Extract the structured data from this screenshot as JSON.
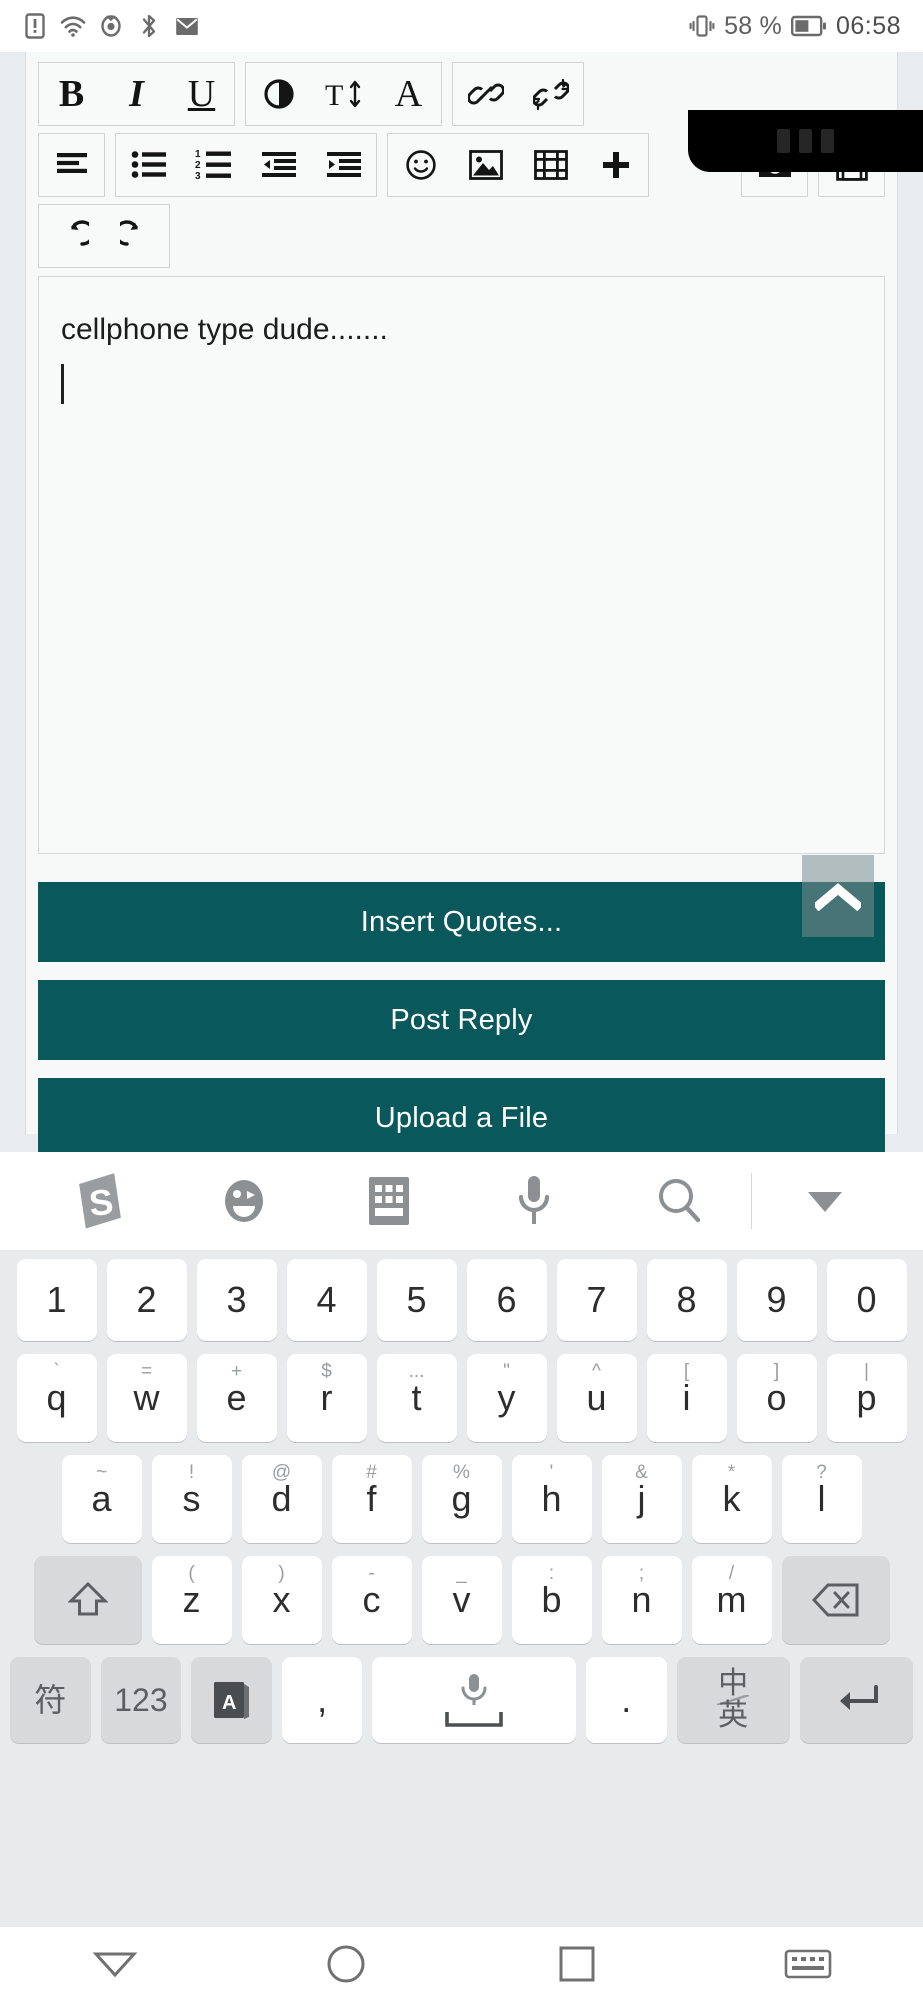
{
  "status_bar": {
    "left_icons": [
      "sim-alert-icon",
      "wifi-icon",
      "eye-comfort-icon",
      "bluetooth-icon",
      "mail-icon"
    ],
    "right_icons": [
      "vibrate-icon",
      "battery-icon"
    ],
    "battery_percent": "58 %",
    "clock": "06:58"
  },
  "editor": {
    "toolbar_row1": [
      {
        "name": "bold-icon",
        "label": "B"
      },
      {
        "name": "italic-icon",
        "label": "I"
      },
      {
        "name": "underline-icon",
        "label": "U"
      },
      {
        "name": "text-contrast-icon",
        "label": "O"
      },
      {
        "name": "font-size-icon",
        "label": "T"
      },
      {
        "name": "text-color-icon",
        "label": "A"
      },
      {
        "name": "insert-link-icon",
        "label": ""
      },
      {
        "name": "unlink-icon",
        "label": ""
      }
    ],
    "toolbar_row2": [
      {
        "name": "align-left-icon",
        "label": ""
      },
      {
        "name": "bulleted-list-icon",
        "label": ""
      },
      {
        "name": "numbered-list-icon",
        "label": ""
      },
      {
        "name": "outdent-icon",
        "label": ""
      },
      {
        "name": "indent-icon",
        "label": ""
      },
      {
        "name": "emoji-icon",
        "label": ""
      },
      {
        "name": "insert-image-icon",
        "label": ""
      },
      {
        "name": "insert-video-icon",
        "label": ""
      },
      {
        "name": "more-plus-icon",
        "label": ""
      },
      {
        "name": "camera-icon",
        "label": ""
      },
      {
        "name": "save-draft-icon",
        "label": ""
      }
    ],
    "toolbar_row3": [
      {
        "name": "undo-icon",
        "label": ""
      },
      {
        "name": "redo-icon",
        "label": ""
      }
    ],
    "compose_text": "cellphone type dude.......",
    "compose_placeholder": ""
  },
  "actions": {
    "accent_color": "#09585c",
    "buttons": [
      {
        "name": "insert-quotes-button",
        "label": "Insert Quotes..."
      },
      {
        "name": "post-reply-button",
        "label": "Post Reply"
      },
      {
        "name": "upload-file-button",
        "label": "Upload a File"
      }
    ],
    "scroll_top_icon": "chevron-up-icon"
  },
  "keyboard": {
    "toolbar": [
      "sogou-logo-icon",
      "emoji-face-icon",
      "keyboard-layout-icon",
      "microphone-icon",
      "search-icon",
      "collapse-keyboard-icon"
    ],
    "row1": [
      {
        "main": "1",
        "sub": ""
      },
      {
        "main": "2",
        "sub": ""
      },
      {
        "main": "3",
        "sub": ""
      },
      {
        "main": "4",
        "sub": ""
      },
      {
        "main": "5",
        "sub": ""
      },
      {
        "main": "6",
        "sub": ""
      },
      {
        "main": "7",
        "sub": ""
      },
      {
        "main": "8",
        "sub": ""
      },
      {
        "main": "9",
        "sub": ""
      },
      {
        "main": "0",
        "sub": ""
      }
    ],
    "row2": [
      {
        "main": "q",
        "sub": "`"
      },
      {
        "main": "w",
        "sub": "="
      },
      {
        "main": "e",
        "sub": "+"
      },
      {
        "main": "r",
        "sub": "$"
      },
      {
        "main": "t",
        "sub": "..."
      },
      {
        "main": "y",
        "sub": "\""
      },
      {
        "main": "u",
        "sub": "^"
      },
      {
        "main": "i",
        "sub": "["
      },
      {
        "main": "o",
        "sub": "]"
      },
      {
        "main": "p",
        "sub": "|"
      }
    ],
    "row3": [
      {
        "main": "a",
        "sub": "~"
      },
      {
        "main": "s",
        "sub": "!"
      },
      {
        "main": "d",
        "sub": "@"
      },
      {
        "main": "f",
        "sub": "#"
      },
      {
        "main": "g",
        "sub": "%"
      },
      {
        "main": "h",
        "sub": "'"
      },
      {
        "main": "j",
        "sub": "&"
      },
      {
        "main": "k",
        "sub": "*"
      },
      {
        "main": "l",
        "sub": "?"
      }
    ],
    "row4": [
      {
        "main": "z",
        "sub": "("
      },
      {
        "main": "x",
        "sub": ")"
      },
      {
        "main": "c",
        "sub": "-"
      },
      {
        "main": "v",
        "sub": "_"
      },
      {
        "main": "b",
        "sub": ":"
      },
      {
        "main": "n",
        "sub": ";"
      },
      {
        "main": "m",
        "sub": "/"
      }
    ],
    "shift_key": "shift-icon",
    "backspace_key": "backspace-icon",
    "row5": {
      "symbol": "符",
      "numbers": "123",
      "abc": "A",
      "comma": ",",
      "space_icon": "microphone-space-icon",
      "period": ".",
      "lang_top": "中",
      "lang_bottom": "英",
      "enter_icon": "enter-icon"
    }
  },
  "navbar": [
    "back-icon",
    "home-icon",
    "recents-icon",
    "keyboard-toggle-icon"
  ]
}
